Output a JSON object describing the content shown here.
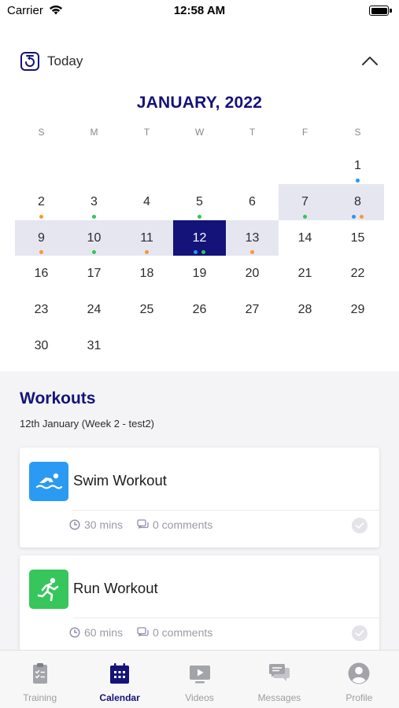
{
  "status_bar": {
    "carrier": "Carrier",
    "time": "12:58 AM"
  },
  "header": {
    "today_label": "Today"
  },
  "calendar": {
    "month_title": "JANUARY, 2022",
    "weekdays": [
      "S",
      "M",
      "T",
      "W",
      "T",
      "F",
      "S"
    ],
    "weeks": [
      [
        null,
        null,
        null,
        null,
        null,
        null,
        {
          "day": "1",
          "dots": [
            "blue"
          ]
        }
      ],
      [
        {
          "day": "2",
          "dots": [
            "orange"
          ]
        },
        {
          "day": "3",
          "dots": [
            "green"
          ]
        },
        {
          "day": "4",
          "dots": []
        },
        {
          "day": "5",
          "dots": [
            "green"
          ]
        },
        {
          "day": "6",
          "dots": []
        },
        {
          "day": "7",
          "dots": [
            "green"
          ],
          "range": true
        },
        {
          "day": "8",
          "dots": [
            "blue",
            "orange"
          ],
          "range": true
        }
      ],
      [
        {
          "day": "9",
          "dots": [
            "orange"
          ],
          "range": true
        },
        {
          "day": "10",
          "dots": [
            "green"
          ],
          "range": true
        },
        {
          "day": "11",
          "dots": [
            "orange"
          ],
          "range": true
        },
        {
          "day": "12",
          "dots": [
            "blue",
            "green"
          ],
          "selected": true
        },
        {
          "day": "13",
          "dots": [
            "orange"
          ],
          "range": true
        },
        {
          "day": "14",
          "dots": []
        },
        {
          "day": "15",
          "dots": []
        }
      ],
      [
        {
          "day": "16",
          "dots": []
        },
        {
          "day": "17",
          "dots": []
        },
        {
          "day": "18",
          "dots": []
        },
        {
          "day": "19",
          "dots": []
        },
        {
          "day": "20",
          "dots": []
        },
        {
          "day": "21",
          "dots": []
        },
        {
          "day": "22",
          "dots": []
        }
      ],
      [
        {
          "day": "23",
          "dots": []
        },
        {
          "day": "24",
          "dots": []
        },
        {
          "day": "25",
          "dots": []
        },
        {
          "day": "26",
          "dots": []
        },
        {
          "day": "27",
          "dots": []
        },
        {
          "day": "28",
          "dots": []
        },
        {
          "day": "29",
          "dots": []
        }
      ],
      [
        {
          "day": "30",
          "dots": []
        },
        {
          "day": "31",
          "dots": []
        },
        null,
        null,
        null,
        null,
        null
      ]
    ]
  },
  "workouts": {
    "title": "Workouts",
    "subtitle": "12th January (Week 2 - test2)",
    "items": [
      {
        "title": "Swim Workout",
        "duration": "30 mins",
        "comments": "0 comments",
        "icon": "swim-icon",
        "color": "#2b9af3"
      },
      {
        "title": "Run Workout",
        "duration": "60 mins",
        "comments": "0 comments",
        "icon": "run-icon",
        "color": "#37c65c"
      }
    ]
  },
  "tabs": [
    {
      "label": "Training",
      "icon": "clipboard-icon",
      "active": false
    },
    {
      "label": "Calendar",
      "icon": "calendar-icon",
      "active": true
    },
    {
      "label": "Videos",
      "icon": "video-icon",
      "active": false
    },
    {
      "label": "Messages",
      "icon": "messages-icon",
      "active": false
    },
    {
      "label": "Profile",
      "icon": "profile-icon",
      "active": false
    }
  ],
  "colors": {
    "accent": "#14137a",
    "range": "#e6e6f1",
    "dot_orange": "#f59a33",
    "dot_green": "#35c35b",
    "dot_blue": "#2a95f0"
  }
}
